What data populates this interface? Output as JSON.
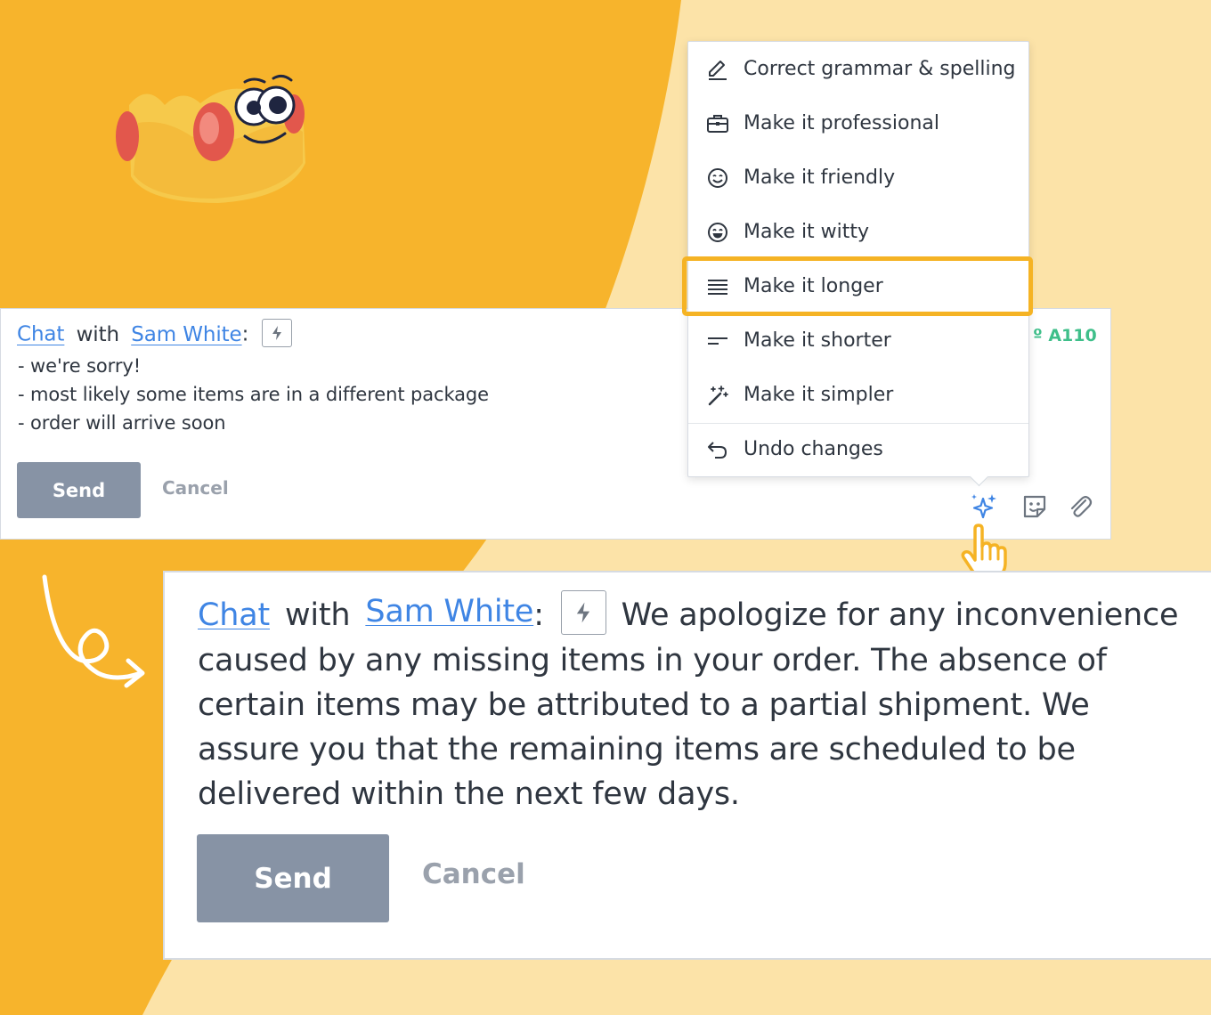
{
  "colors": {
    "background_light": "#fce3a8",
    "background_orange": "#f7b42c",
    "accent_highlight": "#f5b324",
    "link": "#3f85e4",
    "send_button": "#8793a5",
    "ticket_green": "#3fbf8a",
    "ai_icon": "#3f85e4"
  },
  "compose_small": {
    "chat_label": "Chat",
    "with_label": "with",
    "contact_name": "Sam White",
    "colon": ":",
    "lines": [
      "- we're sorry!",
      "- most likely some items are in a different package",
      "- order will arrive soon"
    ],
    "send_label": "Send",
    "cancel_label": "Cancel",
    "ticket_number": "º A110",
    "toolbar_icons": [
      "ai-sparkles-icon",
      "sticker-icon",
      "paperclip-icon"
    ]
  },
  "ai_menu": {
    "items": [
      {
        "label": "Correct grammar & spelling",
        "icon": "pencil-icon"
      },
      {
        "label": "Make it professional",
        "icon": "briefcase-icon"
      },
      {
        "label": "Make it friendly",
        "icon": "smile-icon"
      },
      {
        "label": "Make it witty",
        "icon": "laugh-icon"
      },
      {
        "label": "Make it longer",
        "icon": "lines-long-icon",
        "highlighted": true
      },
      {
        "label": "Make it shorter",
        "icon": "lines-short-icon"
      },
      {
        "label": "Make it simpler",
        "icon": "magic-wand-icon"
      },
      {
        "label": "Undo changes",
        "icon": "undo-icon"
      }
    ]
  },
  "compose_large": {
    "chat_label": "Chat",
    "with_label": "with",
    "contact_name": "Sam White",
    "colon": ":",
    "message": "We apologize for any inconvenience caused by any missing items in your order. The absence of certain items may be attributed to a partial shipment. We assure you that the remaining items are scheduled to be delivered within the next few days.",
    "send_label": "Send",
    "cancel_label": "Cancel"
  }
}
